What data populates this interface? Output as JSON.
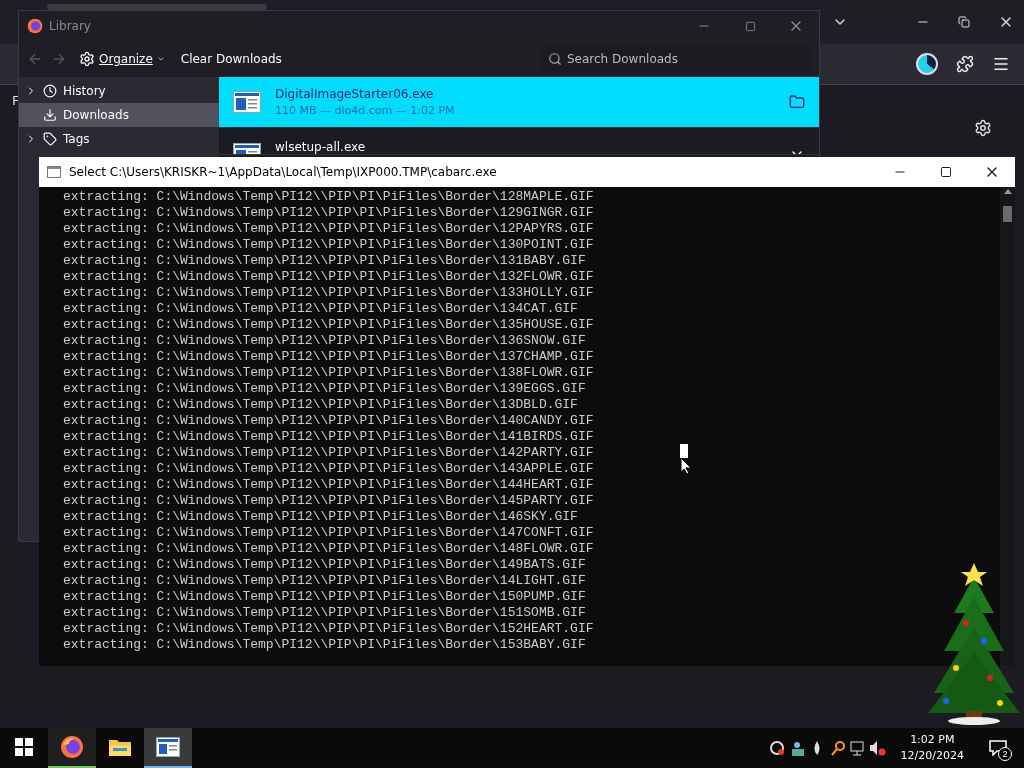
{
  "browser": {
    "partial_text": "F"
  },
  "library": {
    "title": "Library",
    "organize": "Organize",
    "clear": "Clear Downloads",
    "search_placeholder": "Search Downloads",
    "sidebar": [
      {
        "kind": "history",
        "label": "History",
        "selected": false
      },
      {
        "kind": "downloads",
        "label": "Downloads",
        "selected": true
      },
      {
        "kind": "tags",
        "label": "Tags",
        "selected": false
      }
    ],
    "downloads": [
      {
        "name": "DigitalImageStarter06.exe",
        "details": "110 MB — dlo4d.com — 1:02 PM",
        "selected": true
      },
      {
        "name": "wlsetup-all.exe",
        "selected": false
      }
    ]
  },
  "console": {
    "title": "Select C:\\Users\\KRISKR~1\\AppData\\Local\\Temp\\IXP000.TMP\\cabarc.exe",
    "lines": [
      "extracting: C:\\Windows\\Temp\\PI12\\\\PIP\\PI\\PiFiles\\Border\\128MAPLE.GIF",
      "extracting: C:\\Windows\\Temp\\PI12\\\\PIP\\PI\\PiFiles\\Border\\129GINGR.GIF",
      "extracting: C:\\Windows\\Temp\\PI12\\\\PIP\\PI\\PiFiles\\Border\\12PAPYRS.GIF",
      "extracting: C:\\Windows\\Temp\\PI12\\\\PIP\\PI\\PiFiles\\Border\\130POINT.GIF",
      "extracting: C:\\Windows\\Temp\\PI12\\\\PIP\\PI\\PiFiles\\Border\\131BABY.GIF",
      "extracting: C:\\Windows\\Temp\\PI12\\\\PIP\\PI\\PiFiles\\Border\\132FLOWR.GIF",
      "extracting: C:\\Windows\\Temp\\PI12\\\\PIP\\PI\\PiFiles\\Border\\133HOLLY.GIF",
      "extracting: C:\\Windows\\Temp\\PI12\\\\PIP\\PI\\PiFiles\\Border\\134CAT.GIF",
      "extracting: C:\\Windows\\Temp\\PI12\\\\PIP\\PI\\PiFiles\\Border\\135HOUSE.GIF",
      "extracting: C:\\Windows\\Temp\\PI12\\\\PIP\\PI\\PiFiles\\Border\\136SNOW.GIF",
      "extracting: C:\\Windows\\Temp\\PI12\\\\PIP\\PI\\PiFiles\\Border\\137CHAMP.GIF",
      "extracting: C:\\Windows\\Temp\\PI12\\\\PIP\\PI\\PiFiles\\Border\\138FLOWR.GIF",
      "extracting: C:\\Windows\\Temp\\PI12\\\\PIP\\PI\\PiFiles\\Border\\139EGGS.GIF",
      "extracting: C:\\Windows\\Temp\\PI12\\\\PIP\\PI\\PiFiles\\Border\\13DBLD.GIF",
      "extracting: C:\\Windows\\Temp\\PI12\\\\PIP\\PI\\PiFiles\\Border\\140CANDY.GIF",
      "extracting: C:\\Windows\\Temp\\PI12\\\\PIP\\PI\\PiFiles\\Border\\141BIRDS.GIF",
      "extracting: C:\\Windows\\Temp\\PI12\\\\PIP\\PI\\PiFiles\\Border\\142PARTY.GIF",
      "extracting: C:\\Windows\\Temp\\PI12\\\\PIP\\PI\\PiFiles\\Border\\143APPLE.GIF",
      "extracting: C:\\Windows\\Temp\\PI12\\\\PIP\\PI\\PiFiles\\Border\\144HEART.GIF",
      "extracting: C:\\Windows\\Temp\\PI12\\\\PIP\\PI\\PiFiles\\Border\\145PARTY.GIF",
      "extracting: C:\\Windows\\Temp\\PI12\\\\PIP\\PI\\PiFiles\\Border\\146SKY.GIF",
      "extracting: C:\\Windows\\Temp\\PI12\\\\PIP\\PI\\PiFiles\\Border\\147CONFT.GIF",
      "extracting: C:\\Windows\\Temp\\PI12\\\\PIP\\PI\\PiFiles\\Border\\148FLOWR.GIF",
      "extracting: C:\\Windows\\Temp\\PI12\\\\PIP\\PI\\PiFiles\\Border\\149BATS.GIF",
      "extracting: C:\\Windows\\Temp\\PI12\\\\PIP\\PI\\PiFiles\\Border\\14LIGHT.GIF",
      "extracting: C:\\Windows\\Temp\\PI12\\\\PIP\\PI\\PiFiles\\Border\\150PUMP.GIF",
      "extracting: C:\\Windows\\Temp\\PI12\\\\PIP\\PI\\PiFiles\\Border\\151SOMB.GIF",
      "extracting: C:\\Windows\\Temp\\PI12\\\\PIP\\PI\\PiFiles\\Border\\152HEART.GIF",
      "extracting: C:\\Windows\\Temp\\PI12\\\\PIP\\PI\\PiFiles\\Border\\153BABY.GIF"
    ]
  },
  "taskbar": {
    "apps": [
      {
        "kind": "firefox",
        "running": true,
        "selected": false
      },
      {
        "kind": "explorer",
        "running": false,
        "selected": false
      },
      {
        "kind": "console",
        "running": true,
        "selected": true
      }
    ],
    "time": "1:02 PM",
    "date": "12/20/2024",
    "notifications": "2"
  }
}
